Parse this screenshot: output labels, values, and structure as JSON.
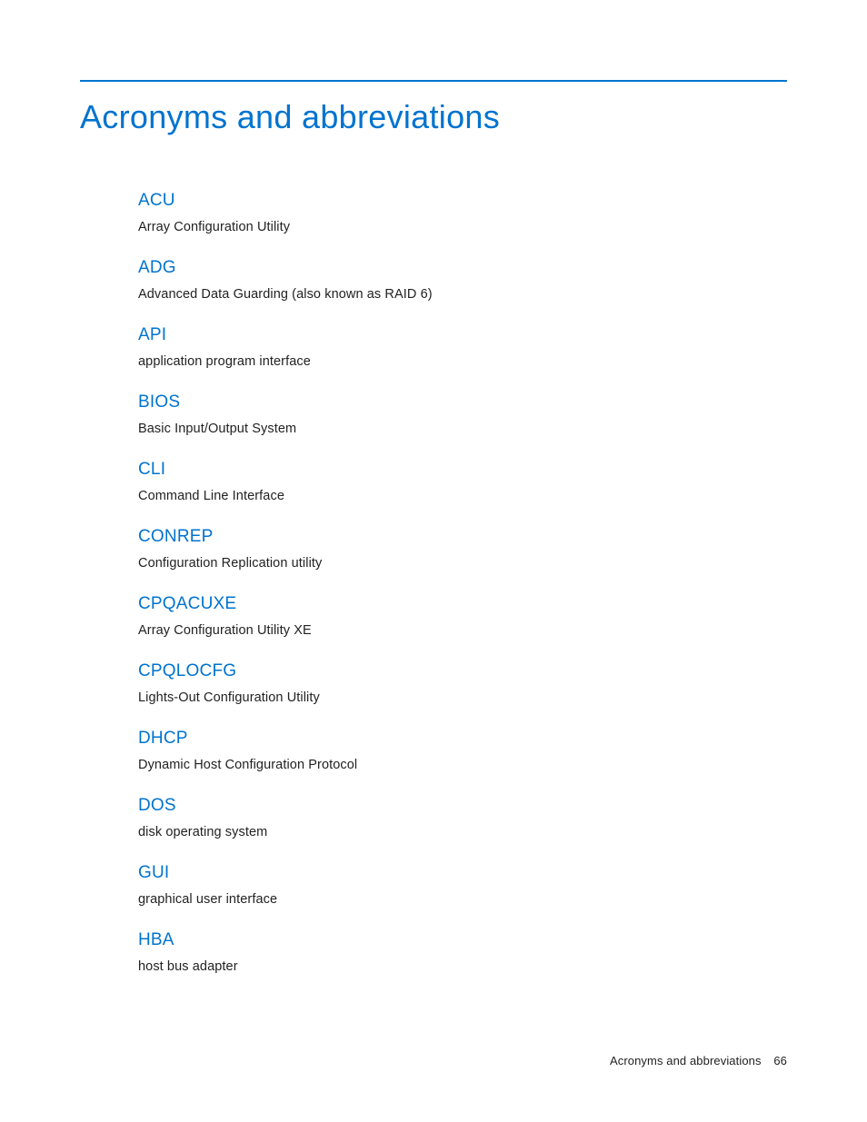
{
  "title": "Acronyms and abbreviations",
  "entries": [
    {
      "term": "ACU",
      "def": "Array Configuration Utility"
    },
    {
      "term": "ADG",
      "def": "Advanced Data Guarding (also known as RAID 6)"
    },
    {
      "term": "API",
      "def": "application program interface"
    },
    {
      "term": "BIOS",
      "def": "Basic Input/Output System"
    },
    {
      "term": "CLI",
      "def": "Command Line Interface"
    },
    {
      "term": "CONREP",
      "def": "Configuration Replication utility"
    },
    {
      "term": "CPQACUXE",
      "def": "Array Configuration Utility XE"
    },
    {
      "term": "CPQLOCFG",
      "def": "Lights-Out Configuration Utility"
    },
    {
      "term": "DHCP",
      "def": "Dynamic Host Configuration Protocol"
    },
    {
      "term": "DOS",
      "def": "disk operating system"
    },
    {
      "term": "GUI",
      "def": "graphical user interface"
    },
    {
      "term": "HBA",
      "def": "host bus adapter"
    }
  ],
  "footer": {
    "label": "Acronyms and abbreviations",
    "page": "66"
  }
}
